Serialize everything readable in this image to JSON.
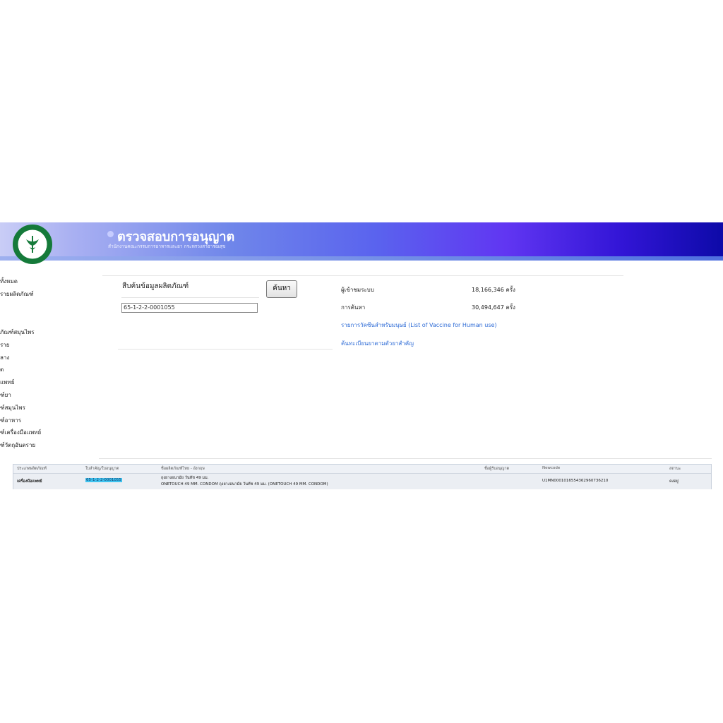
{
  "header": {
    "title": "ตรวจสอบการอนุญาต",
    "subtitle": "สำนักงานคณะกรรมการอาหารและยา กระทรวงสาธารณสุข"
  },
  "sidebar": {
    "items": [
      "ทั้งหมด",
      "รายผลิตภัณฑ์",
      "ภัณฑ์สมุนไพร",
      "ราย",
      "ลาง",
      "ต",
      "แพทย์",
      "ฑ์ยา",
      "ฑ์สมุนไพร",
      "ฑ์อาหาร",
      "ฑ์เครื่องมือแพทย์",
      "ฑ์วัตถุอันตราย"
    ]
  },
  "search": {
    "title": "สืบค้นข้อมูลผลิตภัณฑ์",
    "button": "ค้นหา",
    "value": "65-1-2-2-0001055"
  },
  "stats": [
    {
      "label": "ผู้เข้าชมระบบ",
      "value": "18,166,346 ครั้ง"
    },
    {
      "label": "การค้นหา",
      "value": "30,494,647 ครั้ง"
    }
  ],
  "links": [
    "รายการวัคซีนสำหรับมนุษย์ (List of Vaccine for Human use)",
    "ค้นทะเบียนยาตามตัวยาสำคัญ"
  ],
  "table": {
    "columns": [
      "ประเภทผลิตภัณฑ์",
      "ใบสำคัญ/ใบอนุญาต",
      "ชื่อผลิตภัณฑ์ไทย - อังกฤษ",
      "ชื่อผู้รับอนุญาต",
      "Newcode",
      "สถานะ"
    ],
    "rows": [
      {
        "type": "เครื่องมือแพทย์",
        "license": "65-1-2-2-0001055",
        "name_line1": "ถุงยางอนามัย วันทัช 49 มม.",
        "name_line2": "ONETOUCH 49 MM. CONDOM ถุงยางอนามัย วันทัช 49 มม. (ONETOUCH 49 MM. CONDOM)",
        "licensee": "",
        "newcode": "U1MN0001016554362960736210",
        "status": "คงอยู่"
      }
    ]
  },
  "colors": {
    "banner_start": "#c9cdf6",
    "banner_end": "#0d0aa8",
    "link": "#2d6bd6",
    "highlight": "#3fc3ef"
  }
}
